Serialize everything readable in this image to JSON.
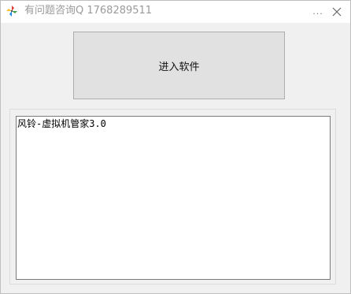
{
  "window": {
    "title": "有问题咨询Q 1768289511",
    "more_glyph": "...",
    "icons": {
      "app": "pinwheel-icon",
      "close": "close-icon"
    }
  },
  "main": {
    "enter_button_label": "进入软件",
    "output_text": "风铃-虚拟机管家3.0"
  }
}
